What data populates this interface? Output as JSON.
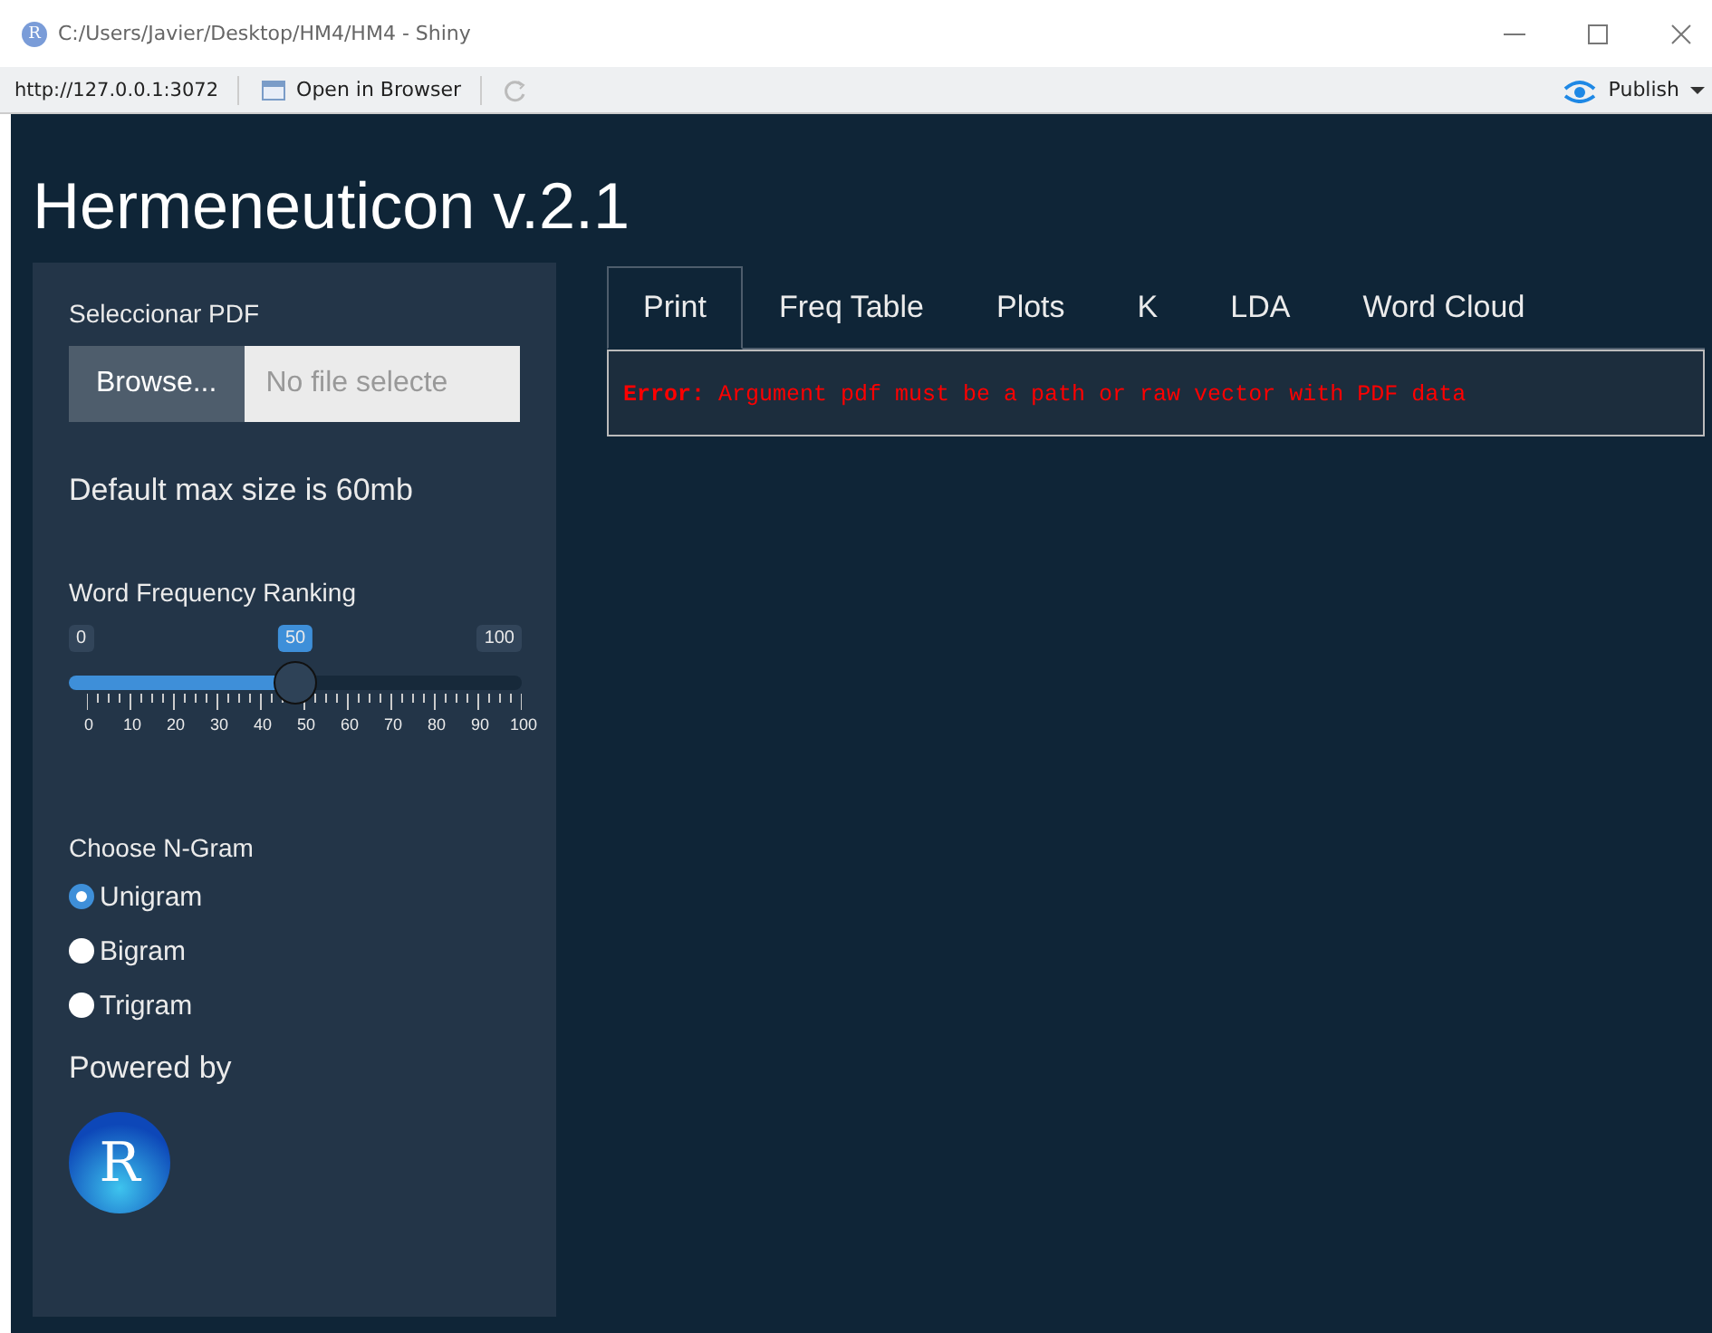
{
  "window": {
    "icon_letter": "R",
    "title": "C:/Users/Javier/Desktop/HM4/HM4 - Shiny"
  },
  "toolbar": {
    "url": "http://127.0.0.1:3072",
    "open_in_browser": "Open in Browser",
    "publish": "Publish"
  },
  "app_title": "Hermeneuticon v.2.1",
  "sidebar": {
    "file_label": "Seleccionar PDF",
    "browse": "Browse...",
    "file_placeholder": "No file selecte",
    "note": "Default max size is 60mb",
    "slider": {
      "label": "Word Frequency Ranking",
      "min": "0",
      "max": "100",
      "value": "50",
      "level": 0.5,
      "ticks": [
        "0",
        "10",
        "20",
        "30",
        "40",
        "50",
        "60",
        "70",
        "80",
        "90",
        "100"
      ]
    },
    "ngram": {
      "label": "Choose N-Gram",
      "options": [
        {
          "label": "Unigram",
          "selected": true
        },
        {
          "label": "Bigram",
          "selected": false
        },
        {
          "label": "Trigram",
          "selected": false
        }
      ]
    },
    "powered_by": "Powered by",
    "logo_letter": "R"
  },
  "tabs": [
    {
      "label": "Print",
      "selected": true
    },
    {
      "label": "Freq Table",
      "selected": false
    },
    {
      "label": "Plots",
      "selected": false
    },
    {
      "label": "K",
      "selected": false
    },
    {
      "label": "LDA",
      "selected": false
    },
    {
      "label": "Word Cloud",
      "selected": false
    }
  ],
  "output": "**Error:** Argument pdf must be a path or raw vector with PDF data"
}
